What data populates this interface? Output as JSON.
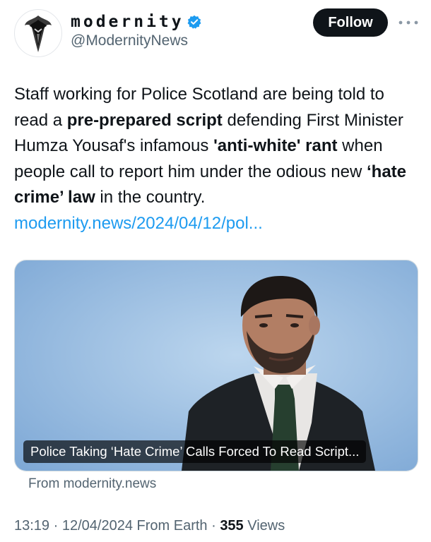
{
  "author": {
    "display_name": "modernity",
    "handle": "@ModernityNews",
    "avatar_icon": "bird-head-icon",
    "verified_icon": "verified-badge-icon",
    "verified_color": "#1d9bf0"
  },
  "actions": {
    "follow_label": "Follow",
    "more_icon": "more-dots-icon"
  },
  "tweet": {
    "segments": [
      "Staff working for Police Scotland are being told to read a ",
      "pre-prepared script",
      " defending First Minister Humza Yousaf's infamous ",
      "'anti-white' rant",
      " when people call to report him under the odious new ",
      "‘hate crime’ law",
      " in the country."
    ],
    "link": "modernity.news/2024/04/12/pol..."
  },
  "card": {
    "caption": "Police Taking ‘Hate Crime’ Calls Forced To Read Script...",
    "source": "From modernity.news"
  },
  "meta": {
    "time": "13:19",
    "separator": " · ",
    "date": "12/04/2024",
    "location": " From Earth",
    "views_count": "355",
    "views_label": " Views"
  },
  "colors": {
    "text": "#0f1419",
    "secondary": "#536471",
    "link": "#1d9bf0",
    "button_bg": "#0f1419"
  }
}
